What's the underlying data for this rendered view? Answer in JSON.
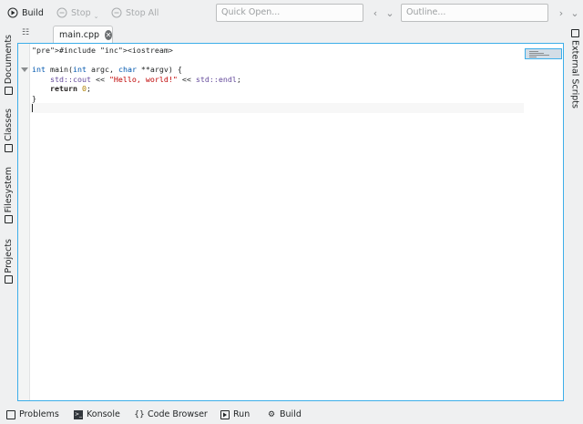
{
  "toolbar": {
    "build_label": "Build",
    "stop_label": "Stop",
    "stop_all_label": "Stop All",
    "quick_open_placeholder": "Quick Open...",
    "outline_placeholder": "Outline..."
  },
  "left_dock": {
    "tabs": [
      {
        "label": "Documents",
        "icon": "documents-icon"
      },
      {
        "label": "Classes",
        "icon": "classes-icon"
      },
      {
        "label": "Filesystem",
        "icon": "filesystem-icon"
      },
      {
        "label": "Projects",
        "icon": "projects-icon"
      }
    ]
  },
  "right_dock": {
    "tabs": [
      {
        "label": "External Scripts",
        "icon": "external-scripts-icon"
      }
    ]
  },
  "editor": {
    "tab_label": "main.cpp",
    "lines": [
      "#include <iostream>",
      "",
      "int main(int argc, char **argv) {",
      "    std::cout << \"Hello, world!\" << std::endl;",
      "    return 0;",
      "}",
      ""
    ]
  },
  "bottom_bar": {
    "problems": "Problems",
    "konsole": "Konsole",
    "code_browser": "Code Browser",
    "run": "Run",
    "build": "Build"
  },
  "colors": {
    "accent": "#3daee9",
    "string": "#bf0303",
    "number": "#b08000",
    "type": "#0057ae",
    "namespace": "#644a9b"
  }
}
